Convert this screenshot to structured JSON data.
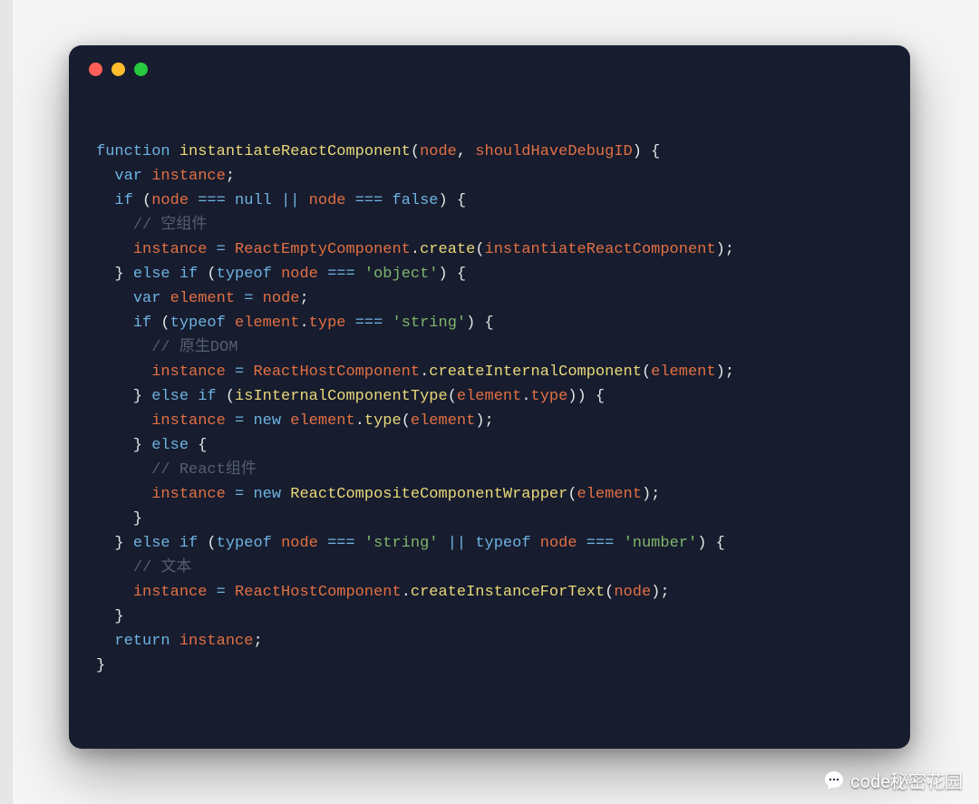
{
  "window": {
    "dots": [
      "#ff5f56",
      "#ffbd2e",
      "#27c93f"
    ]
  },
  "code": {
    "lines": [
      [
        [
          "k",
          "function"
        ],
        [
          "p",
          " "
        ],
        [
          "fn",
          "instantiateReactComponent"
        ],
        [
          "p",
          "("
        ],
        [
          "id",
          "node"
        ],
        [
          "p",
          ", "
        ],
        [
          "id",
          "shouldHaveDebugID"
        ],
        [
          "p",
          ") {"
        ]
      ],
      [
        [
          "p",
          "  "
        ],
        [
          "k",
          "var"
        ],
        [
          "p",
          " "
        ],
        [
          "id",
          "instance"
        ],
        [
          "p",
          ";"
        ]
      ],
      [
        [
          "p",
          "  "
        ],
        [
          "k",
          "if"
        ],
        [
          "p",
          " ("
        ],
        [
          "id",
          "node"
        ],
        [
          "p",
          " "
        ],
        [
          "op",
          "==="
        ],
        [
          "p",
          " "
        ],
        [
          "nl",
          "null"
        ],
        [
          "p",
          " "
        ],
        [
          "op",
          "||"
        ],
        [
          "p",
          " "
        ],
        [
          "id",
          "node"
        ],
        [
          "p",
          " "
        ],
        [
          "op",
          "==="
        ],
        [
          "p",
          " "
        ],
        [
          "nl",
          "false"
        ],
        [
          "p",
          ") {"
        ]
      ],
      [
        [
          "p",
          "    "
        ],
        [
          "cm",
          "// 空组件"
        ]
      ],
      [
        [
          "p",
          "    "
        ],
        [
          "id",
          "instance"
        ],
        [
          "p",
          " "
        ],
        [
          "op",
          "="
        ],
        [
          "p",
          " "
        ],
        [
          "id",
          "ReactEmptyComponent"
        ],
        [
          "p",
          "."
        ],
        [
          "fn",
          "create"
        ],
        [
          "p",
          "("
        ],
        [
          "id",
          "instantiateReactComponent"
        ],
        [
          "p",
          ");"
        ]
      ],
      [
        [
          "p",
          "  } "
        ],
        [
          "k",
          "else"
        ],
        [
          "p",
          " "
        ],
        [
          "k",
          "if"
        ],
        [
          "p",
          " ("
        ],
        [
          "k",
          "typeof"
        ],
        [
          "p",
          " "
        ],
        [
          "id",
          "node"
        ],
        [
          "p",
          " "
        ],
        [
          "op",
          "==="
        ],
        [
          "p",
          " "
        ],
        [
          "str",
          "'object'"
        ],
        [
          "p",
          ") {"
        ]
      ],
      [
        [
          "p",
          "    "
        ],
        [
          "k",
          "var"
        ],
        [
          "p",
          " "
        ],
        [
          "id",
          "element"
        ],
        [
          "p",
          " "
        ],
        [
          "op",
          "="
        ],
        [
          "p",
          " "
        ],
        [
          "id",
          "node"
        ],
        [
          "p",
          ";"
        ]
      ],
      [
        [
          "p",
          "    "
        ],
        [
          "k",
          "if"
        ],
        [
          "p",
          " ("
        ],
        [
          "k",
          "typeof"
        ],
        [
          "p",
          " "
        ],
        [
          "id",
          "element"
        ],
        [
          "p",
          "."
        ],
        [
          "id",
          "type"
        ],
        [
          "p",
          " "
        ],
        [
          "op",
          "==="
        ],
        [
          "p",
          " "
        ],
        [
          "str",
          "'string'"
        ],
        [
          "p",
          ") {"
        ]
      ],
      [
        [
          "p",
          "      "
        ],
        [
          "cm",
          "// 原生DOM"
        ]
      ],
      [
        [
          "p",
          "      "
        ],
        [
          "id",
          "instance"
        ],
        [
          "p",
          " "
        ],
        [
          "op",
          "="
        ],
        [
          "p",
          " "
        ],
        [
          "id",
          "ReactHostComponent"
        ],
        [
          "p",
          "."
        ],
        [
          "fn",
          "createInternalComponent"
        ],
        [
          "p",
          "("
        ],
        [
          "id",
          "element"
        ],
        [
          "p",
          ");"
        ]
      ],
      [
        [
          "p",
          "    } "
        ],
        [
          "k",
          "else"
        ],
        [
          "p",
          " "
        ],
        [
          "k",
          "if"
        ],
        [
          "p",
          " ("
        ],
        [
          "fn",
          "isInternalComponentType"
        ],
        [
          "p",
          "("
        ],
        [
          "id",
          "element"
        ],
        [
          "p",
          "."
        ],
        [
          "id",
          "type"
        ],
        [
          "p",
          ")) {"
        ]
      ],
      [
        [
          "p",
          "      "
        ],
        [
          "id",
          "instance"
        ],
        [
          "p",
          " "
        ],
        [
          "op",
          "="
        ],
        [
          "p",
          " "
        ],
        [
          "k",
          "new"
        ],
        [
          "p",
          " "
        ],
        [
          "id",
          "element"
        ],
        [
          "p",
          "."
        ],
        [
          "fn",
          "type"
        ],
        [
          "p",
          "("
        ],
        [
          "id",
          "element"
        ],
        [
          "p",
          ");"
        ]
      ],
      [
        [
          "p",
          "    } "
        ],
        [
          "k",
          "else"
        ],
        [
          "p",
          " {"
        ]
      ],
      [
        [
          "p",
          "      "
        ],
        [
          "cm",
          "// React组件"
        ]
      ],
      [
        [
          "p",
          "      "
        ],
        [
          "id",
          "instance"
        ],
        [
          "p",
          " "
        ],
        [
          "op",
          "="
        ],
        [
          "p",
          " "
        ],
        [
          "k",
          "new"
        ],
        [
          "p",
          " "
        ],
        [
          "fn",
          "ReactCompositeComponentWrapper"
        ],
        [
          "p",
          "("
        ],
        [
          "id",
          "element"
        ],
        [
          "p",
          ");"
        ]
      ],
      [
        [
          "p",
          "    }"
        ]
      ],
      [
        [
          "p",
          "  } "
        ],
        [
          "k",
          "else"
        ],
        [
          "p",
          " "
        ],
        [
          "k",
          "if"
        ],
        [
          "p",
          " ("
        ],
        [
          "k",
          "typeof"
        ],
        [
          "p",
          " "
        ],
        [
          "id",
          "node"
        ],
        [
          "p",
          " "
        ],
        [
          "op",
          "==="
        ],
        [
          "p",
          " "
        ],
        [
          "str",
          "'string'"
        ],
        [
          "p",
          " "
        ],
        [
          "op",
          "||"
        ],
        [
          "p",
          " "
        ],
        [
          "k",
          "typeof"
        ],
        [
          "p",
          " "
        ],
        [
          "id",
          "node"
        ],
        [
          "p",
          " "
        ],
        [
          "op",
          "==="
        ],
        [
          "p",
          " "
        ],
        [
          "str",
          "'number'"
        ],
        [
          "p",
          ") {"
        ]
      ],
      [
        [
          "p",
          "    "
        ],
        [
          "cm",
          "// 文本"
        ]
      ],
      [
        [
          "p",
          "    "
        ],
        [
          "id",
          "instance"
        ],
        [
          "p",
          " "
        ],
        [
          "op",
          "="
        ],
        [
          "p",
          " "
        ],
        [
          "id",
          "ReactHostComponent"
        ],
        [
          "p",
          "."
        ],
        [
          "fn",
          "createInstanceForText"
        ],
        [
          "p",
          "("
        ],
        [
          "id",
          "node"
        ],
        [
          "p",
          ");"
        ]
      ],
      [
        [
          "p",
          "  }"
        ]
      ],
      [
        [
          "p",
          "  "
        ],
        [
          "k",
          "return"
        ],
        [
          "p",
          " "
        ],
        [
          "id",
          "instance"
        ],
        [
          "p",
          ";"
        ]
      ],
      [
        [
          "p",
          "}"
        ]
      ]
    ]
  },
  "watermark": {
    "text": "code秘密花园",
    "icon": "chat-bubble-icon"
  }
}
